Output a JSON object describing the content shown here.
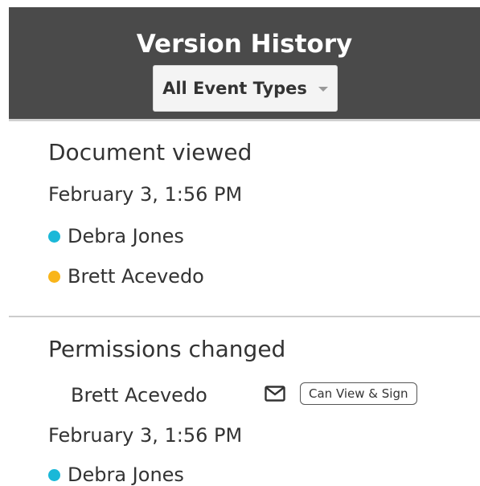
{
  "header": {
    "title": "Version History",
    "filter_label": "All Event Types"
  },
  "events": [
    {
      "title": "Document viewed",
      "date": "February 3, 1:56 PM",
      "participants": [
        {
          "name": "Debra Jones",
          "color": "#1ab8d8"
        },
        {
          "name": "Brett Acevedo",
          "color": "#f9b51a"
        }
      ]
    },
    {
      "title": "Permissions changed",
      "permission": {
        "name": "Brett Acevedo",
        "icon": "mail-icon",
        "badge": "Can View & Sign"
      },
      "date": "February 3, 1:56 PM",
      "participants": [
        {
          "name": "Debra Jones",
          "color": "#1ab8d8"
        }
      ]
    }
  ]
}
